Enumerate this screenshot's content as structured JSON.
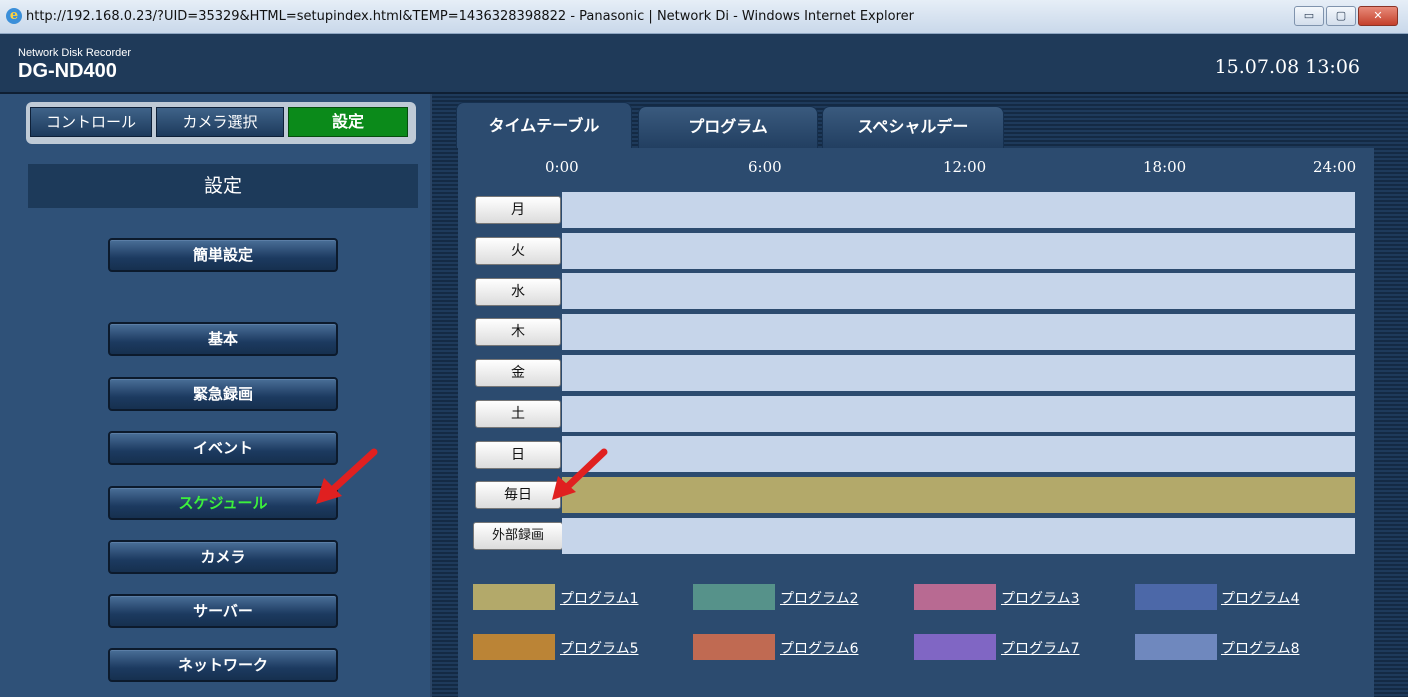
{
  "window": {
    "title": "http://192.168.0.23/?UID=35329&HTML=setupindex.html&TEMP=1436328398822 - Panasonic | Network Di - Windows Internet Explorer",
    "btn_min": "▭",
    "btn_max": "▢",
    "btn_close": "✕"
  },
  "header": {
    "product_line": "Network Disk Recorder",
    "model": "DG-ND400",
    "datetime": "15.07.08 13:06"
  },
  "mode_tabs": [
    "コントロール",
    "カメラ選択",
    "設定"
  ],
  "sidebar": {
    "heading": "設定",
    "buttons": [
      "簡単設定",
      "基本",
      "緊急録画",
      "イベント",
      "スケジュール",
      "カメラ",
      "サーバー",
      "ネットワーク"
    ],
    "selected": "スケジュール"
  },
  "tabs": [
    "タイムテーブル",
    "プログラム",
    "スペシャルデー"
  ],
  "timeline": {
    "hours": [
      "0:00",
      "6:00",
      "12:00",
      "18:00",
      "24:00"
    ],
    "rows": [
      "月",
      "火",
      "水",
      "木",
      "金",
      "土",
      "日",
      "毎日",
      "外部録画"
    ],
    "filled_row": "毎日"
  },
  "legend": [
    {
      "label": "プログラム1",
      "color": "#b3a96a"
    },
    {
      "label": "プログラム2",
      "color": "#56928a"
    },
    {
      "label": "プログラム3",
      "color": "#b86a92"
    },
    {
      "label": "プログラム4",
      "color": "#4c68a8"
    },
    {
      "label": "プログラム5",
      "color": "#bb8436"
    },
    {
      "label": "プログラム6",
      "color": "#c06a52"
    },
    {
      "label": "プログラム7",
      "color": "#8066c4"
    },
    {
      "label": "プログラム8",
      "color": "#6f88be"
    }
  ],
  "colors": {
    "selected_text": "#3cf03c",
    "active_mode": "#0b8a1a",
    "arrow": "#e02020"
  }
}
